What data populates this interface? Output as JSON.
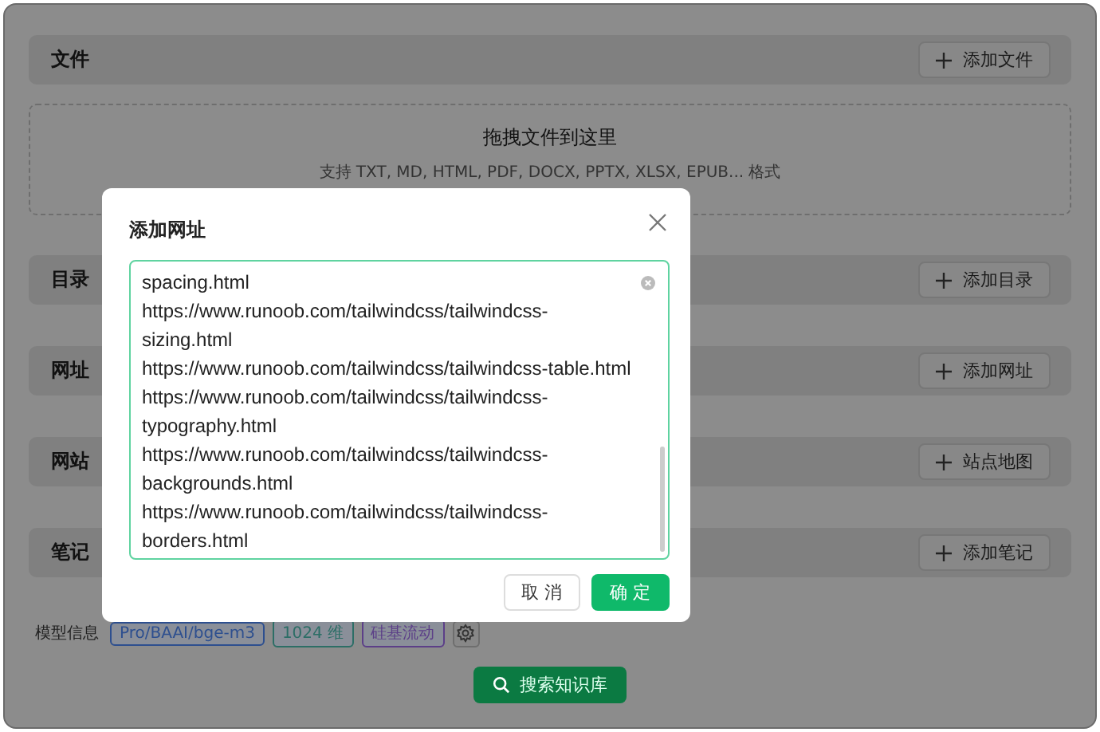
{
  "sections": [
    {
      "title": "文件",
      "button": "添加文件",
      "dropzone": {
        "title": "拖拽文件到这里",
        "hint": "支持 TXT, MD, HTML, PDF, DOCX, PPTX, XLSX, EPUB... 格式"
      }
    },
    {
      "title": "目录",
      "button": "添加目录"
    },
    {
      "title": "网址",
      "button": "添加网址"
    },
    {
      "title": "网站",
      "button": "站点地图"
    },
    {
      "title": "笔记",
      "button": "添加笔记"
    }
  ],
  "model_info": {
    "label": "模型信息",
    "tags": [
      {
        "text": "Pro/BAAI/bge-m3",
        "color": "#2d4f8f"
      },
      {
        "text": "1024 维",
        "color": "#2c6e66"
      },
      {
        "text": "硅基流动",
        "color": "#5c3f88"
      }
    ]
  },
  "search_button": "搜索知识库",
  "dialog": {
    "title": "添加网址",
    "urls": [
      "spacing.html",
      "https://www.runoob.com/tailwindcss/tailwindcss-sizing.html",
      "https://www.runoob.com/tailwindcss/tailwindcss-table.html",
      "https://www.runoob.com/tailwindcss/tailwindcss-typography.html",
      "https://www.runoob.com/tailwindcss/tailwindcss-backgrounds.html",
      "https://www.runoob.com/tailwindcss/tailwindcss-borders.html"
    ],
    "cancel": "取 消",
    "ok": "确 定"
  }
}
